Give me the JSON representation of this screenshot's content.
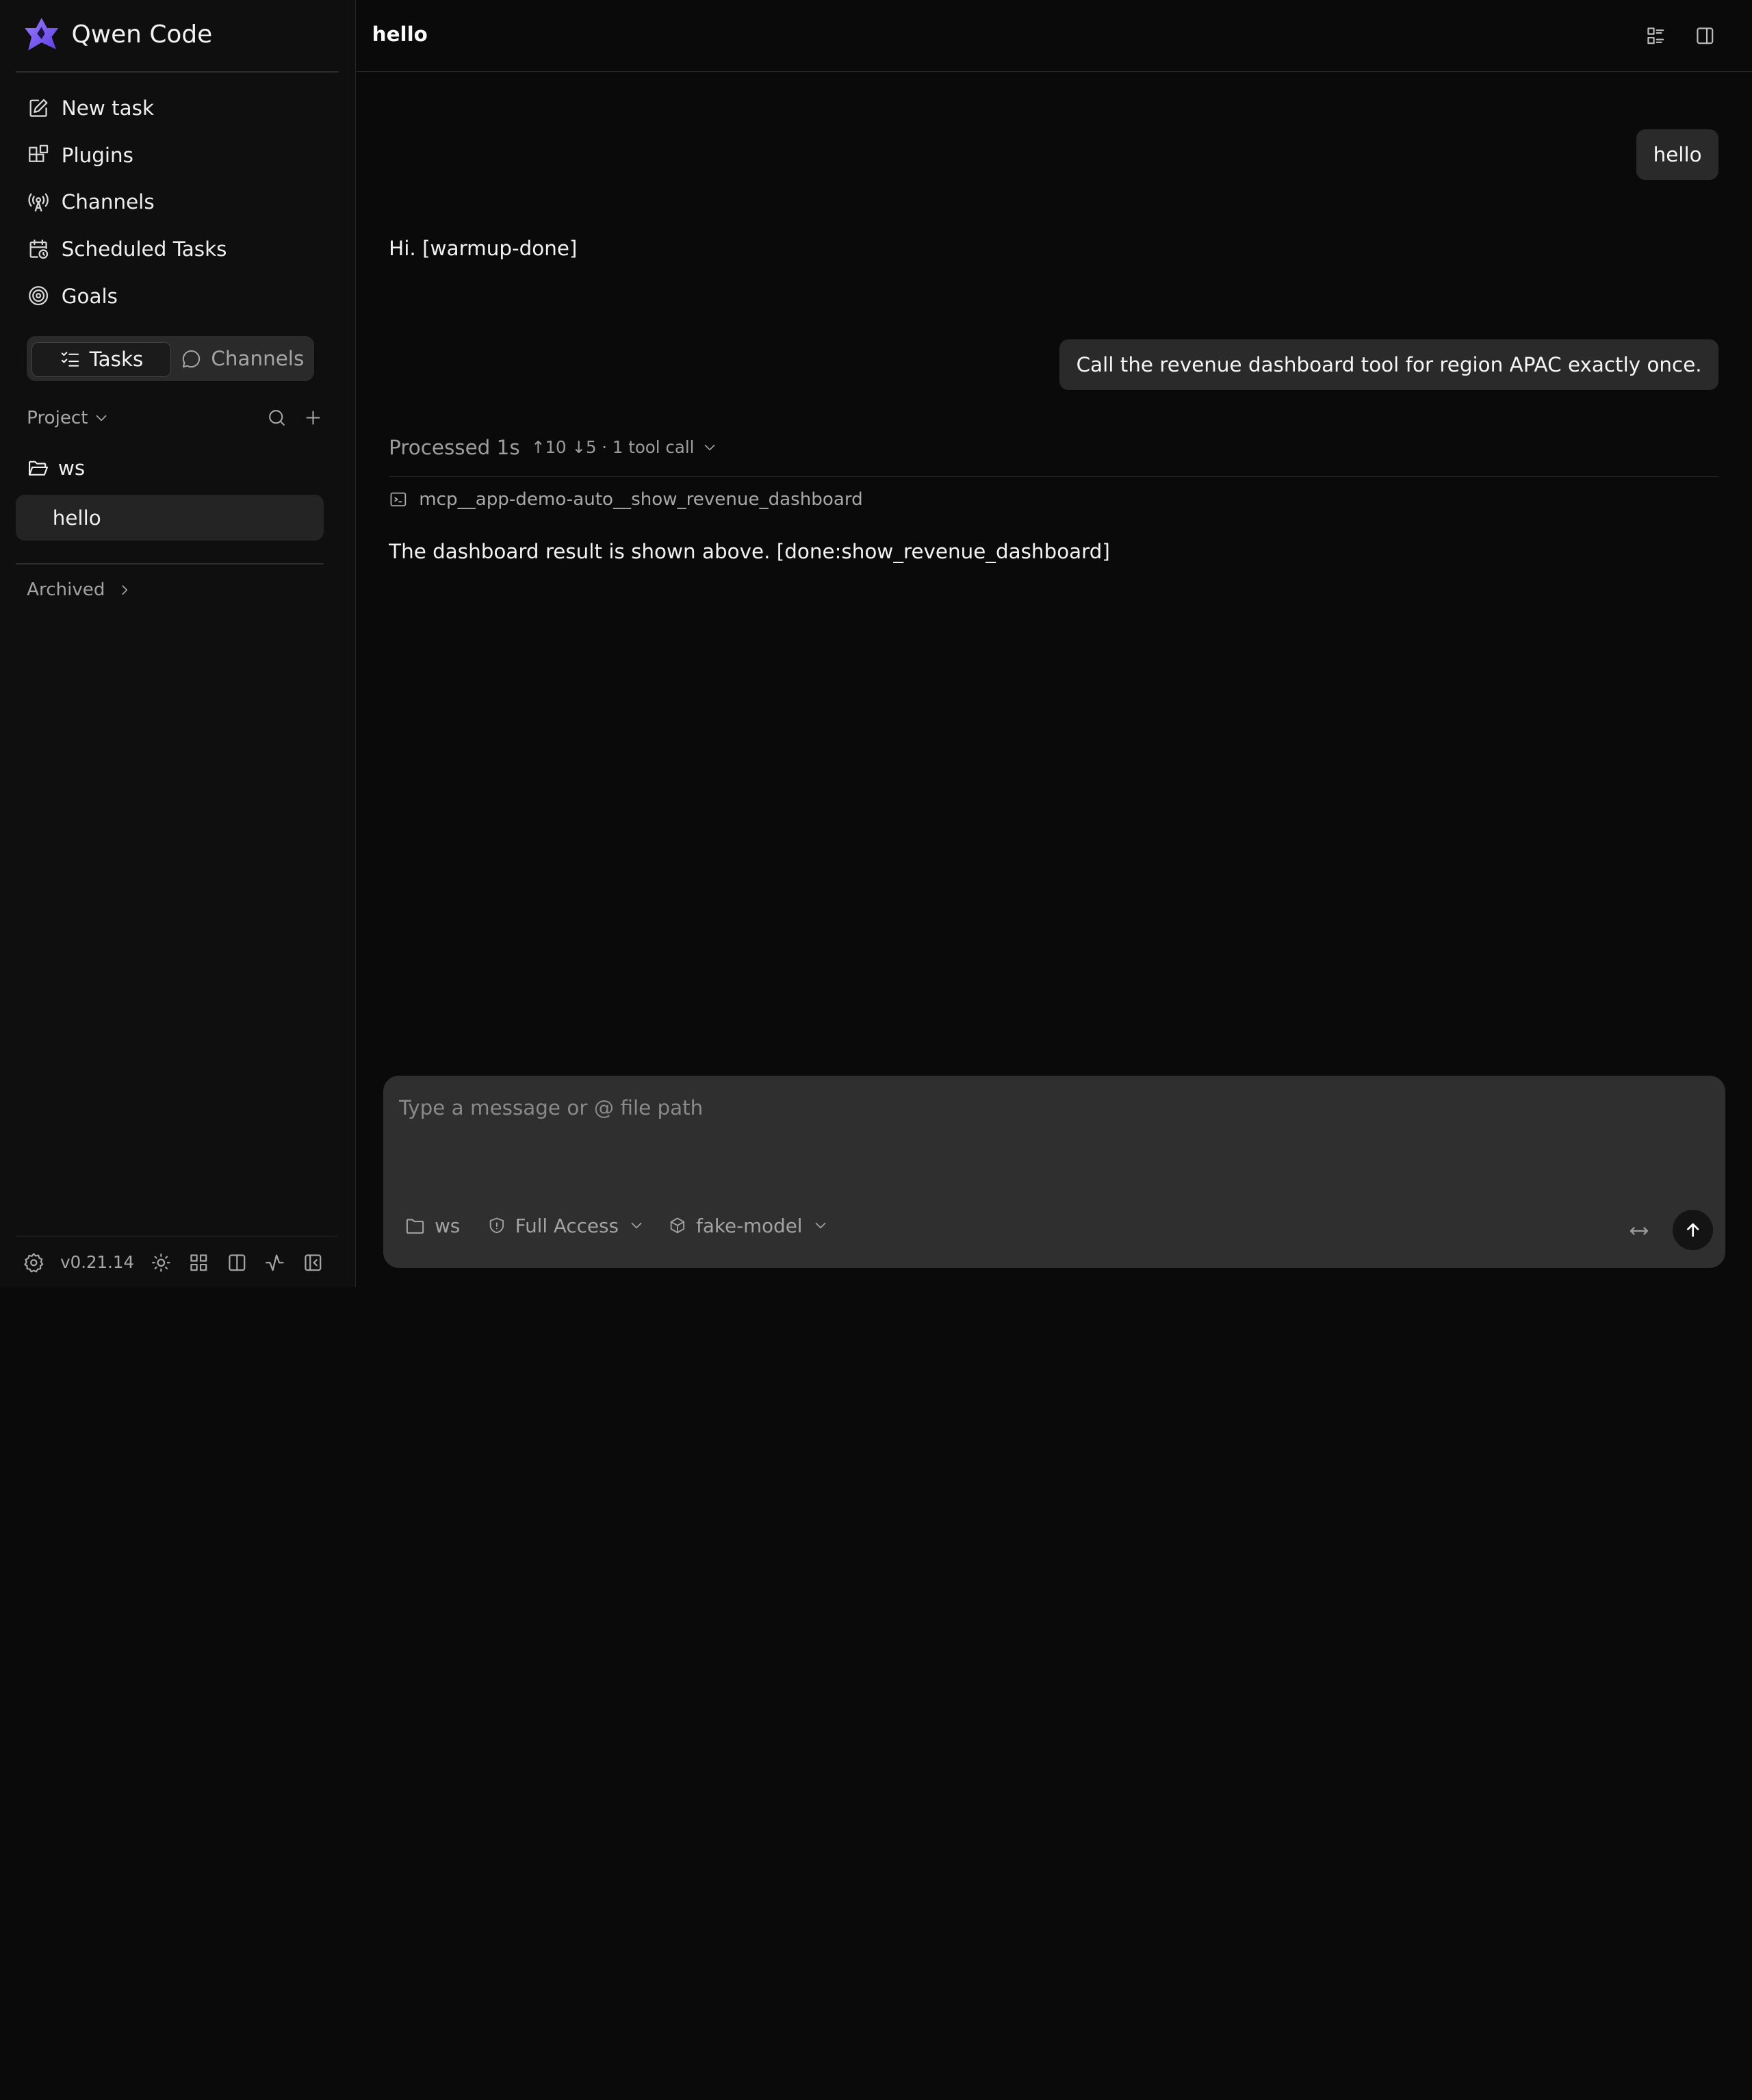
{
  "app": {
    "brand_name": "Qwen Code",
    "version": "v0.21.14",
    "colors": {
      "background": "#0a0a0a",
      "sidebar": "#0f0f0f",
      "bubble": "#2a2a2a",
      "composer": "#2f2f2f",
      "logo_accent": "#7c5cff"
    }
  },
  "sidebar": {
    "nav": [
      {
        "label": "New task",
        "icon": "edit-icon"
      },
      {
        "label": "Plugins",
        "icon": "puzzle-icon"
      },
      {
        "label": "Channels",
        "icon": "broadcast-icon"
      },
      {
        "label": "Scheduled Tasks",
        "icon": "calendar-clock-icon"
      },
      {
        "label": "Goals",
        "icon": "target-icon"
      }
    ],
    "segment": {
      "tasks_label": "Tasks",
      "channels_label": "Channels",
      "active": "Tasks"
    },
    "project_label": "Project",
    "folder_name": "ws",
    "threads": [
      {
        "label": "hello",
        "selected": true
      }
    ],
    "archived_label": "Archived"
  },
  "header": {
    "title": "hello"
  },
  "conversation": {
    "user_msg_1": "hello",
    "assistant_msg_1": "Hi. [warmup-done]",
    "user_msg_2": "Call the revenue dashboard tool for region APAC exactly once.",
    "processed_label": "Processed 1s",
    "processed_meta": "↑10 ↓5 · 1 tool call",
    "tool_name": "mcp__app-demo-auto__show_revenue_dashboard",
    "assistant_msg_2": "The dashboard result is shown above. [done:show_revenue_dashboard]"
  },
  "composer": {
    "placeholder": "Type a message or @ file path",
    "value": "",
    "workspace": "ws",
    "access": "Full Access",
    "model": "fake-model"
  }
}
